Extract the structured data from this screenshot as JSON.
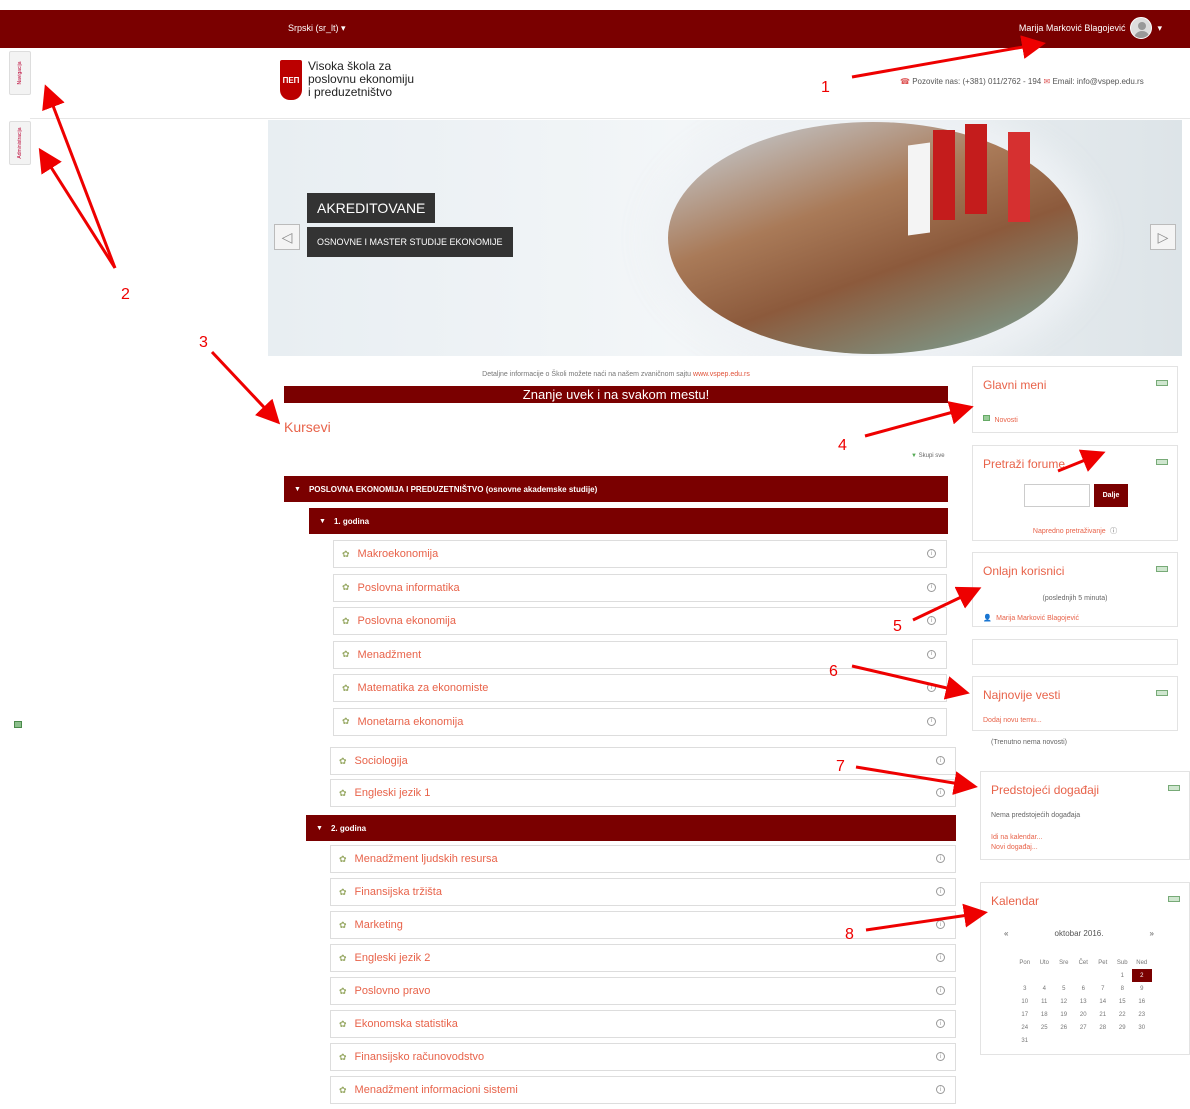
{
  "topbar": {
    "language": "Srpski (sr_lt) ▾",
    "user_name": "Marija Marković Blagojević",
    "user_caret": "▾"
  },
  "side_tabs": {
    "navigation": "Navigacija",
    "administration": "Administracija"
  },
  "header": {
    "logo_mark": "ПЕП",
    "logo_line1": "Visoka škola za",
    "logo_line2": "poslovnu ekonomiju",
    "logo_line3": "i preduzetništvo",
    "contact": "Pozovite nas: (+381) 011/2762 - 194",
    "email": "Email: info@vspep.edu.rs"
  },
  "banner": {
    "caption1": "AKREDITOVANE",
    "caption2": "OSNOVNE I MASTER STUDIJE EKONOMIJE",
    "prev": "◁",
    "next": "▷"
  },
  "main": {
    "info_text": "Detaljne informacije o Školi možete naći na našem zvaničnom sajtu",
    "info_link": "www.vspep.edu.rs",
    "slogan": "Znanje uvek i na svakom mestu!",
    "courses_title": "Kursevi",
    "collapse_all": "Skupi sve",
    "category": "POSLOVNA EKONOMIJA I PREDUZETNIŠTVO (osnovne akademske studije)",
    "year1": "1. godina",
    "year2": "2. godina",
    "year1_courses": [
      "Makroekonomija",
      "Poslovna informatika",
      "Poslovna ekonomija",
      "Menadžment",
      "Matematika za ekonomiste",
      "Monetarna ekonomija"
    ],
    "year1_courses_cont": [
      "Sociologija",
      "Engleski jezik 1"
    ],
    "year2_courses": [
      "Menadžment ljudskih resursa",
      "Finansijska tržišta",
      "Marketing",
      "Engleski jezik 2",
      "Poslovno pravo",
      "Ekonomska statistika",
      "Finansijsko računovodstvo",
      "Menadžment informacioni sistemi"
    ]
  },
  "blocks": {
    "main_menu": {
      "title": "Glavni meni",
      "item": "Novosti"
    },
    "search_forums": {
      "title": "Pretraži forume",
      "button": "Dalje",
      "advanced": "Napredno pretraživanje"
    },
    "online_users": {
      "title": "Onlajn korisnici",
      "period": "(poslednjih 5 minuta)",
      "user": "Marija Marković Blagojević"
    },
    "latest_news": {
      "title": "Najnovije vesti",
      "add": "Dodaj novu temu...",
      "none": "(Trenutno nema novosti)"
    },
    "upcoming": {
      "title": "Predstojeći događaji",
      "none": "Nema predstojećih događaja",
      "go_calendar": "Idi na kalendar...",
      "new_event": "Novi događaj..."
    },
    "calendar": {
      "title": "Kalendar",
      "prev": "«",
      "month": "oktobar 2016.",
      "next": "»",
      "weekdays": [
        "Pon",
        "Uto",
        "Sre",
        "Čet",
        "Pet",
        "Sub",
        "Ned"
      ],
      "weeks": [
        [
          "",
          "",
          "",
          "",
          "",
          "1",
          "2"
        ],
        [
          "3",
          "4",
          "5",
          "6",
          "7",
          "8",
          "9"
        ],
        [
          "10",
          "11",
          "12",
          "13",
          "14",
          "15",
          "16"
        ],
        [
          "17",
          "18",
          "19",
          "20",
          "21",
          "22",
          "23"
        ],
        [
          "24",
          "25",
          "26",
          "27",
          "28",
          "29",
          "30"
        ],
        [
          "31",
          "",
          "",
          "",
          "",
          "",
          ""
        ]
      ],
      "today": "2"
    }
  },
  "annotations": [
    "1",
    "2",
    "3",
    "4",
    "5",
    "6",
    "7",
    "8"
  ],
  "colors": {
    "brand": "#7a0000",
    "link": "#e8634a",
    "annotation": "#e00000"
  }
}
